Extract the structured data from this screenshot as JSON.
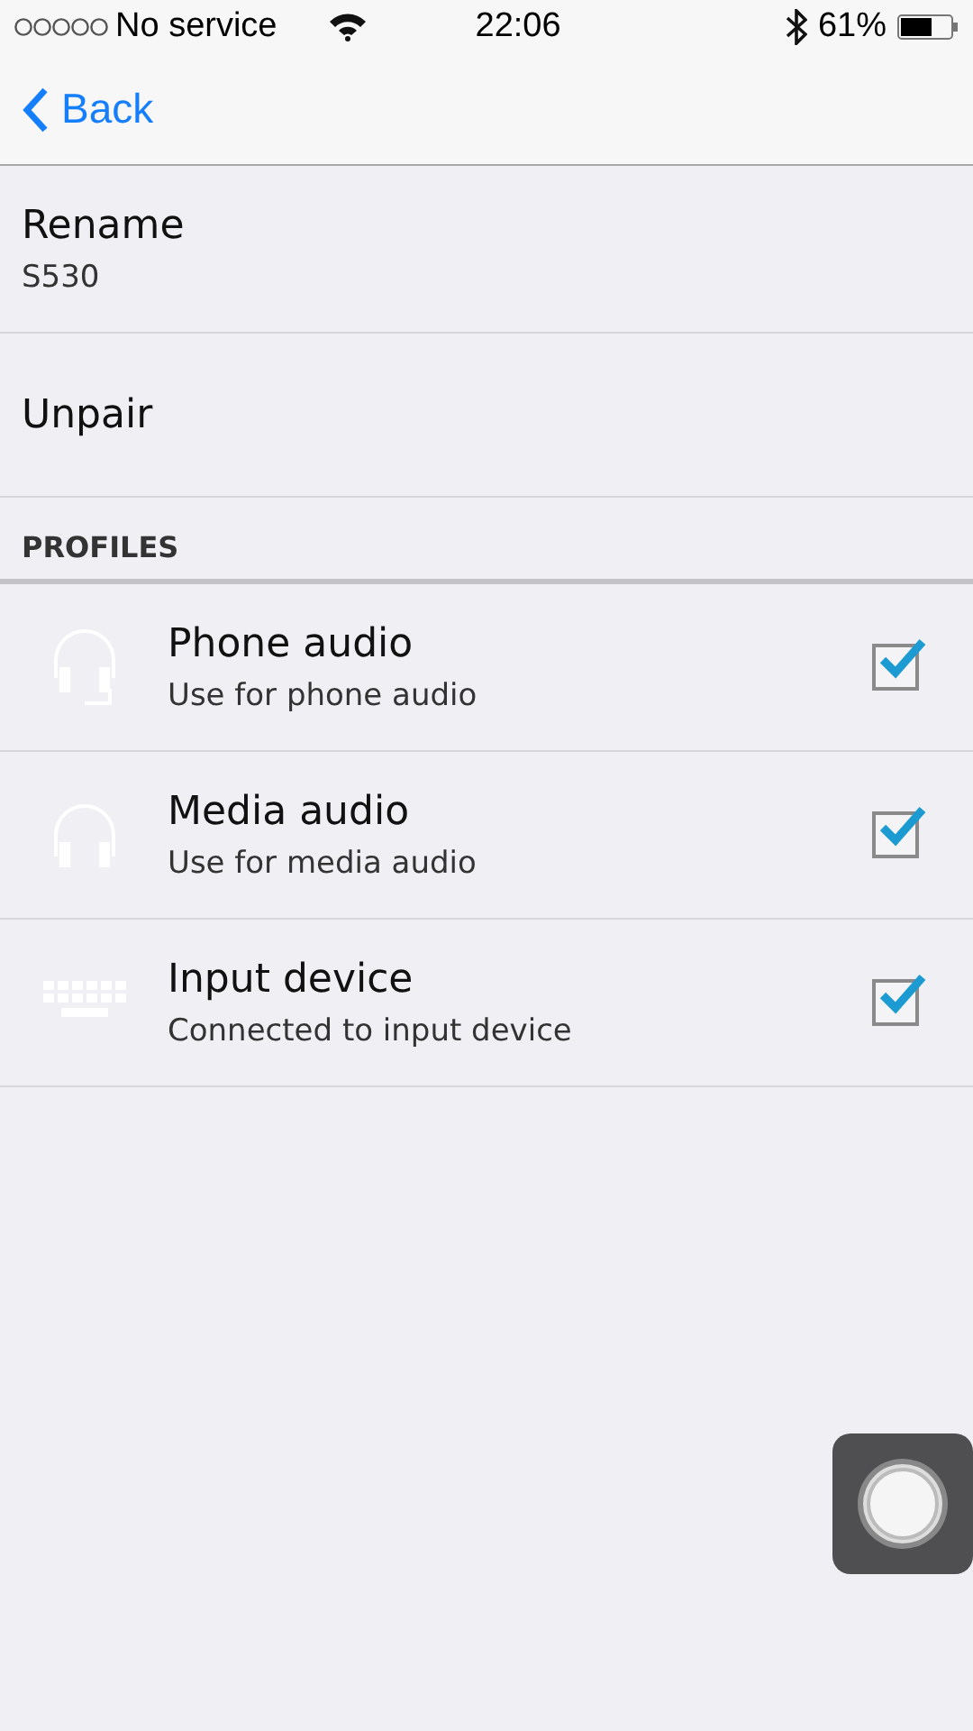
{
  "status_bar": {
    "carrier": "No service",
    "time": "22:06",
    "battery": "61%"
  },
  "nav": {
    "back": "Back"
  },
  "items": [
    {
      "title": "Rename",
      "subtitle": "S530"
    },
    {
      "title": "Unpair"
    }
  ],
  "section": {
    "header": "PROFILES"
  },
  "profiles": [
    {
      "kind": "headset",
      "title": "Phone audio",
      "subtitle": "Use for phone audio",
      "checked": true
    },
    {
      "kind": "headphones",
      "title": "Media audio",
      "subtitle": "Use for media audio",
      "checked": true
    },
    {
      "kind": "keyboard",
      "title": "Input device",
      "subtitle": "Connected to input device",
      "checked": true
    }
  ]
}
